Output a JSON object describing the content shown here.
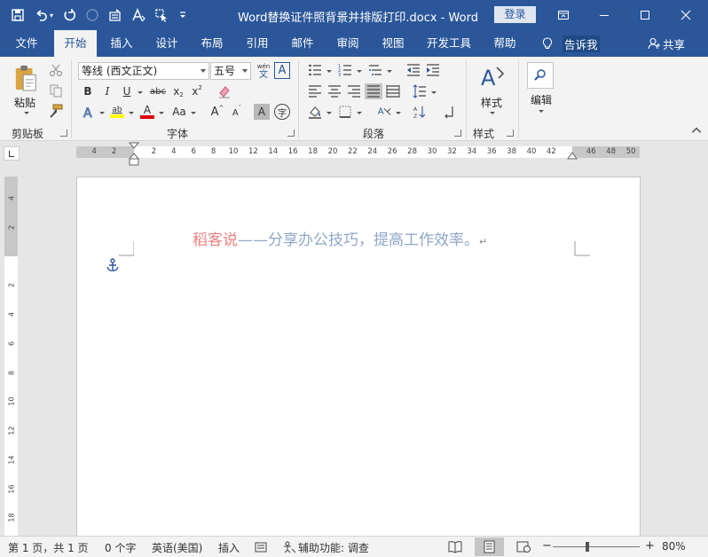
{
  "titlebar": {
    "document_title": "Word替换证件照背景并排版打印.docx  -  Word",
    "login_label": "登录",
    "qat_icons": [
      "save-icon",
      "undo-icon",
      "redo-icon",
      "circle-icon",
      "layout-icon",
      "font-icon",
      "cursor-icon",
      "customize-icon"
    ]
  },
  "tabs": [
    "文件",
    "开始",
    "插入",
    "设计",
    "布局",
    "引用",
    "邮件",
    "审阅",
    "视图",
    "开发工具",
    "帮助"
  ],
  "active_tab": "开始",
  "tellme_label": "告诉我",
  "share_label": "共享",
  "ribbon": {
    "clipboard": {
      "label": "剪贴板",
      "paste_label": "粘贴"
    },
    "font": {
      "label": "字体",
      "font_name": "等线 (西文正文)",
      "font_size": "五号",
      "phonetic_top": "wén",
      "phonetic_bottom": "文",
      "border_char": "A",
      "bold": "B",
      "italic": "I",
      "underline": "U",
      "strike": "abc",
      "sub": "x",
      "sup": "x",
      "grow": "A",
      "shrink": "A",
      "case": "Aa",
      "shade_char": "A",
      "enclose_char": "字",
      "highlight_letters": "ab",
      "fontcolor_char": "A",
      "effects_char": "A",
      "highlight_color": "#ffff00",
      "font_color": "#e00000"
    },
    "paragraph": {
      "label": "段落"
    },
    "styles": {
      "label": "样式",
      "button_label": "样式"
    },
    "editing": {
      "button_label": "编辑"
    }
  },
  "ruler": {
    "left_numbers": [
      "4",
      "2"
    ],
    "right_numbers": [
      "2",
      "4",
      "6",
      "8",
      "10",
      "12",
      "14",
      "16",
      "18",
      "20",
      "22",
      "24",
      "26",
      "28",
      "30",
      "32",
      "34",
      "36",
      "38",
      "40",
      "42"
    ],
    "margin_numbers": [
      "46",
      "48",
      "50"
    ],
    "vertical_numbers": [
      "4",
      "2",
      "",
      "2",
      "4",
      "6",
      "8",
      "10",
      "12",
      "14",
      "16",
      "18"
    ]
  },
  "document": {
    "text_red": "稻客说",
    "text_blue": "——分享办公技巧，提高工作效率。",
    "para_mark": "↵"
  },
  "statusbar": {
    "page": "第 1 页，共 1 页",
    "words": "0 个字",
    "language": "英语(美国)",
    "insert_mode": "插入",
    "accessibility": "辅助功能: 调查",
    "zoom": "80%",
    "zoom_level": 0.5
  }
}
